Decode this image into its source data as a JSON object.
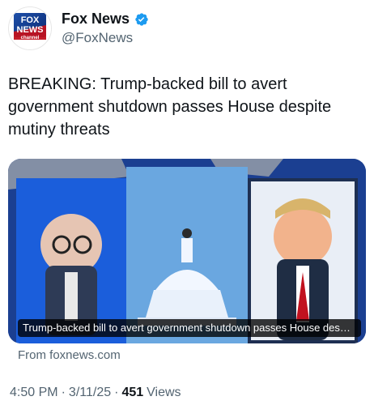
{
  "author": {
    "display_name": "Fox News",
    "handle": "@FoxNews",
    "logo_text_top": "FOX",
    "logo_text_mid": "NEWS",
    "logo_text_bottom": "channel",
    "verified_icon": "verified-badge-icon",
    "brand_color": "#1d9bf0"
  },
  "tweet": {
    "text": "BREAKING: Trump-backed bill to avert government shutdown passes House despite mutiny threats"
  },
  "card": {
    "image_caption": "Trump-backed bill to avert government shutdown passes House despite mutiny threats",
    "source": "From foxnews.com"
  },
  "meta": {
    "time": "4:50 PM",
    "dot1": "·",
    "date": "3/11/25",
    "dot2": "·",
    "views_count": "451",
    "views_label": "Views"
  }
}
